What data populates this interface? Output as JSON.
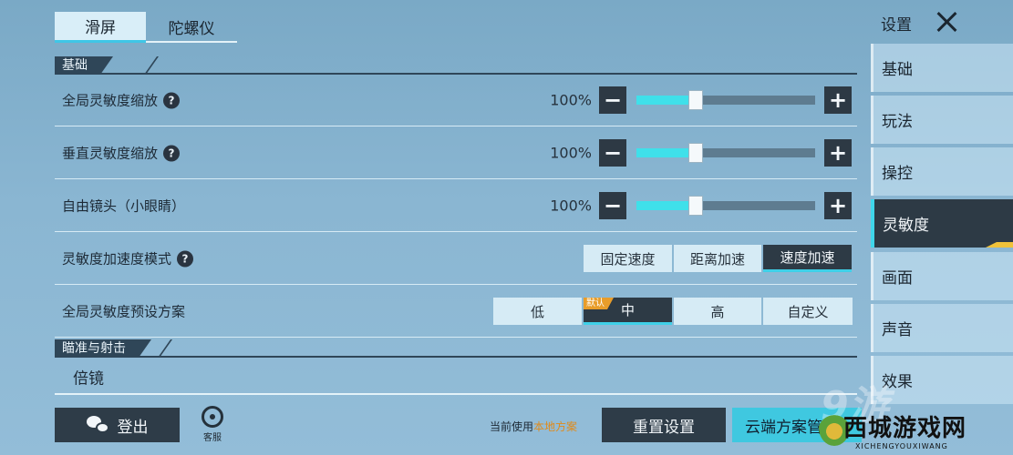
{
  "tabs": [
    {
      "label": "滑屏",
      "active": true
    },
    {
      "label": "陀螺仪",
      "active": false
    }
  ],
  "sections": {
    "basic": "基础",
    "aim": "瞄准与射击"
  },
  "rows": {
    "global_sens": {
      "label": "全局灵敏度缩放",
      "value": "100%",
      "level": 0.33
    },
    "vertical_sens": {
      "label": "垂直灵敏度缩放",
      "value": "100%",
      "level": 0.33
    },
    "free_look": {
      "label": "自由镜头（小眼睛）",
      "value": "100%",
      "level": 0.33
    },
    "accel_mode": {
      "label": "灵敏度加速度模式",
      "options": [
        "固定速度",
        "距离加速",
        "速度加速"
      ],
      "selected": "速度加速"
    },
    "preset": {
      "label": "全局灵敏度预设方案",
      "options": [
        "低",
        "中",
        "高",
        "自定义"
      ],
      "selected": "中",
      "default_badge": "默认"
    },
    "scope": {
      "label": "倍镜"
    }
  },
  "icons": {
    "help": "?",
    "minus": "−",
    "plus": "+"
  },
  "bottom": {
    "logout_label": "登出",
    "service_label": "客服",
    "current_prefix": "当前使用",
    "current_scheme": "本地方案",
    "reset_label": "重置设置",
    "cloud_label": "云端方案管"
  },
  "sidebar": {
    "title": "设置",
    "items": [
      {
        "label": "基础",
        "active": false
      },
      {
        "label": "玩法",
        "active": false
      },
      {
        "label": "操控",
        "active": false
      },
      {
        "label": "灵敏度",
        "active": true
      },
      {
        "label": "画面",
        "active": false
      },
      {
        "label": "声音",
        "active": false
      },
      {
        "label": "效果",
        "active": false
      }
    ]
  },
  "watermark": {
    "big": "西城游戏网",
    "small": "XICHENGYOUXIWANG",
    "ghost": "9游"
  },
  "colors": {
    "accent": "#3fd6ea",
    "dark": "#2d3a45",
    "badge": "#e89d2a",
    "highlight": "#e08a1a"
  }
}
